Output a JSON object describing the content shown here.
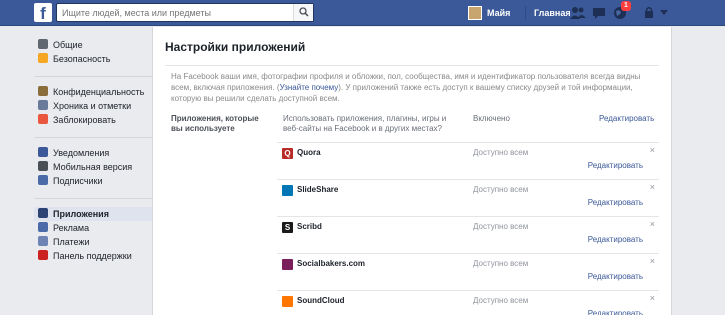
{
  "topbar": {
    "logo": "f",
    "search_placeholder": "Ищите людей, места или предметы",
    "user_name": "Майя",
    "home": "Главная",
    "notification_count": "1"
  },
  "sidebar": {
    "groups": [
      [
        {
          "label": "Общие",
          "icon": "gear-icon",
          "color": "#606770"
        },
        {
          "label": "Безопасность",
          "icon": "lock-icon",
          "color": "#f5a623"
        }
      ],
      [
        {
          "label": "Конфиденциальность",
          "icon": "privacy-icon",
          "color": "#8a6d3b"
        },
        {
          "label": "Хроника и отметки",
          "icon": "timeline-icon",
          "color": "#6a7a9a"
        },
        {
          "label": "Заблокировать",
          "icon": "block-icon",
          "color": "#e9573f"
        }
      ],
      [
        {
          "label": "Уведомления",
          "icon": "globe-icon",
          "color": "#3b5998"
        },
        {
          "label": "Мобильная версия",
          "icon": "mobile-icon",
          "color": "#4b4f56"
        },
        {
          "label": "Подписчики",
          "icon": "rss-icon",
          "color": "#4b6aa8"
        }
      ],
      [
        {
          "label": "Приложения",
          "icon": "apps-icon",
          "color": "#2d4373",
          "active": true
        },
        {
          "label": "Реклама",
          "icon": "ads-icon",
          "color": "#4b6aa8"
        },
        {
          "label": "Платежи",
          "icon": "payments-icon",
          "color": "#6d84b4"
        },
        {
          "label": "Панель поддержки",
          "icon": "support-icon",
          "color": "#cc2222"
        }
      ]
    ]
  },
  "main": {
    "title": "Настройки приложений",
    "intro_before": "На Facebook ваши имя, фотографии профиля и обложки, пол, сообщества, имя и идентификатор пользователя всегда видны всем, включая приложения. (",
    "intro_link": "Узнайте почему",
    "intro_after": "). У приложений также есть доступ к вашему списку друзей и той информации, которую вы решили сделать доступной всем.",
    "section_label": "Приложения, которые вы используете",
    "col_desc": "Использовать приложения, плагины, игры и веб-сайты на Facebook и в других местах?",
    "col_status": "Включено",
    "col_edit": "Редактировать",
    "apps": [
      {
        "name": "Quora",
        "status": "Доступно всем",
        "edit": "Редактировать",
        "icon": "quora-icon",
        "color": "#b92b27",
        "glyph": "Q"
      },
      {
        "name": "SlideShare",
        "status": "Доступно всем",
        "edit": "Редактировать",
        "icon": "slideshare-icon",
        "color": "#0077b5",
        "glyph": ""
      },
      {
        "name": "Scribd",
        "status": "Доступно всем",
        "edit": "Редактировать",
        "icon": "scribd-icon",
        "color": "#1a1a1a",
        "glyph": "S"
      },
      {
        "name": "Socialbakers.com",
        "status": "Доступно всем",
        "edit": "Редактировать",
        "icon": "socialbakers-icon",
        "color": "#7a1f5c",
        "glyph": ""
      },
      {
        "name": "SoundCloud",
        "status": "Доступно всем",
        "edit": "Редактировать",
        "icon": "soundcloud-icon",
        "color": "#ff7700",
        "glyph": ""
      }
    ]
  }
}
